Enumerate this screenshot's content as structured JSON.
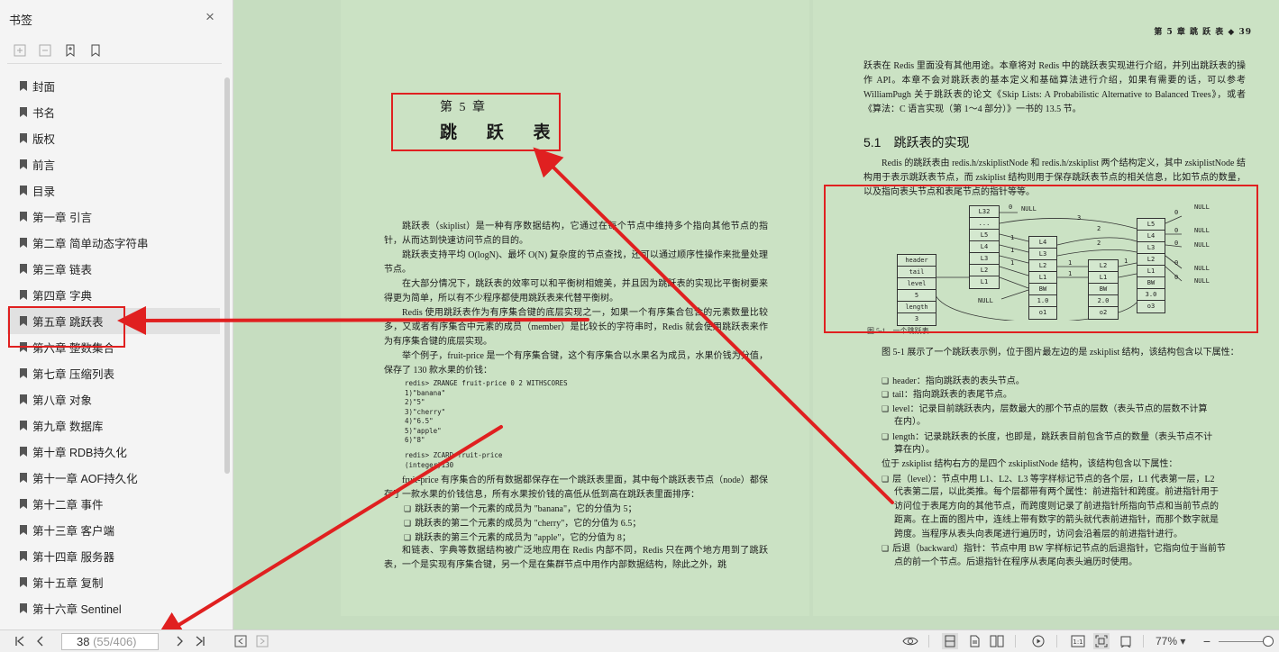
{
  "sidebar": {
    "title": "书签",
    "items": [
      {
        "label": "封面"
      },
      {
        "label": "书名"
      },
      {
        "label": "版权"
      },
      {
        "label": "前言"
      },
      {
        "label": "目录"
      },
      {
        "label": "第一章 引言"
      },
      {
        "label": "第二章 简单动态字符串"
      },
      {
        "label": "第三章 链表"
      },
      {
        "label": "第四章 字典"
      },
      {
        "label": "第五章 跳跃表",
        "selected": true
      },
      {
        "label": "第六章 整数集合"
      },
      {
        "label": "第七章 压缩列表"
      },
      {
        "label": "第八章 对象"
      },
      {
        "label": "第九章 数据库"
      },
      {
        "label": "第十章 RDB持久化"
      },
      {
        "label": "第十一章 AOF持久化"
      },
      {
        "label": "第十二章 事件"
      },
      {
        "label": "第十三章 客户端"
      },
      {
        "label": "第十四章 服务器"
      },
      {
        "label": "第十五章 复制"
      },
      {
        "label": "第十六章 Sentinel"
      }
    ]
  },
  "left_page": {
    "chapter_number": "第 5 章",
    "chapter_title": "跳 跃 表",
    "p1": "跳跃表（skiplist）是一种有序数据结构，它通过在每个节点中维持多个指向其他节点的指针，从而达到快速访问节点的目的。",
    "p2": "跳跃表支持平均 O(logN)、最坏 O(N) 复杂度的节点查找，还可以通过顺序性操作来批量处理节点。",
    "p3": "在大部分情况下，跳跃表的效率可以和平衡树相媲美，并且因为跳跃表的实现比平衡树要来得更为简单，所以有不少程序都使用跳跃表来代替平衡树。",
    "p4": "Redis 使用跳跃表作为有序集合键的底层实现之一，如果一个有序集合包含的元素数量比较多，又或者有序集合中元素的成员（member）是比较长的字符串时，Redis 就会使用跳跃表来作为有序集合键的底层实现。",
    "p5": "举个例子，fruit-price 是一个有序集合键，这个有序集合以水果名为成员，水果价钱为分值，保存了 130 款水果的价钱：",
    "code1": "redis> ZRANGE fruit-price 0 2 WITHSCORES\n1)\"banana\"\n2)\"5\"\n3)\"cherry\"\n4)\"6.5\"\n5)\"apple\"\n6)\"8\"",
    "code2": "redis> ZCARD fruit-price\n(integer)130",
    "p6": "fruit-price 有序集合的所有数据都保存在一个跳跃表里面，其中每个跳跃表节点（node）都保存了一款水果的价钱信息，所有水果按价钱的高低从低到高在跳跃表里面排序：",
    "b1": "跳跃表的第一个元素的成员为 \"banana\"，它的分值为 5；",
    "b2": "跳跃表的第二个元素的成员为 \"cherry\"，它的分值为 6.5；",
    "b3": "跳跃表的第三个元素的成员为 \"apple\"，它的分值为 8；",
    "p7": "和链表、字典等数据结构被广泛地应用在 Redis 内部不同，Redis 只在两个地方用到了跳跃表，一个是实现有序集合键，另一个是在集群节点中用作内部数据结构，除此之外，跳"
  },
  "right_page": {
    "running_head": "第 5 章  跳 跃 表  ◆  39",
    "p1": "跃表在 Redis 里面没有其他用途。本章将对 Redis 中的跳跃表实现进行介绍，并列出跳跃表的操作 API。本章不会对跳跃表的基本定义和基础算法进行介绍，如果有需要的话，可以参考 WilliamPugh 关于跳跃表的论文《Skip Lists: A Probabilistic Alternative to Balanced Trees》，或者《算法：C 语言实现（第 1～4 部分）》一书的 13.5 节。",
    "section_title": "5.1　跳跃表的实现",
    "p2": "Redis 的跳跃表由 redis.h/zskiplistNode 和 redis.h/zskiplist 两个结构定义，其中 zskiplistNode 结构用于表示跳跃表节点，而 zskiplist 结构则用于保存跳跃表节点的相关信息，比如节点的数量，以及指向表头节点和表尾节点的指针等等。",
    "figure_caption": "图 5-1　一个跳跃表",
    "p3": "图 5-1 展示了一个跳跃表示例，位于图片最左边的是 zskiplist 结构，该结构包含以下属性：",
    "b1": "header：指向跳跃表的表头节点。",
    "b2": "tail：指向跳跃表的表尾节点。",
    "b3a": "level：记录目前跳跃表内，层数最大的那个节点的层数（表头节点的层数不计算",
    "b3b": "在内）。",
    "b4a": "length：记录跳跃表的长度，也即是，跳跃表目前包含节点的数量（表头节点不计",
    "b4b": "算在内）。",
    "p4": "位于 zskiplist 结构右方的是四个 zskiplistNode 结构，该结构包含以下属性：",
    "b5a": "层（level）：节点中用 L1、L2、L3 等字样标记节点的各个层，L1 代表第一层，L2",
    "b5b": "代表第二层，以此类推。每个层都带有两个属性：前进指针和跨度。前进指针用于",
    "b5c": "访问位于表尾方向的其他节点，而跨度则记录了前进指针所指向节点和当前节点的",
    "b5d": "距离。在上面的图片中，连线上带有数字的箭头就代表前进指针，而那个数字就是",
    "b5e": "跨度。当程序从表头向表尾进行遍历时，访问会沿着层的前进指针进行。",
    "b6a": "后退（backward）指针：节点中用 BW 字样标记节点的后退指针，它指向位于当前节",
    "b6b": "点的前一个节点。后退指针在程序从表尾向表头遍历时使用。"
  },
  "diagram": {
    "zskiplist_fields": [
      "header",
      "tail",
      "level",
      "5",
      "length",
      "3"
    ],
    "head_levels": [
      "L32",
      "...",
      "L5",
      "L4",
      "L3",
      "L2",
      "L1"
    ],
    "node1": {
      "levels": [
        "L4",
        "L3",
        "L2",
        "L1"
      ],
      "bw": "BW",
      "score": "1.0",
      "obj": "o1"
    },
    "node2": {
      "levels": [
        "L2",
        "L1"
      ],
      "bw": "BW",
      "score": "2.0",
      "obj": "o2"
    },
    "node3": {
      "levels": [
        "L5",
        "L4",
        "L3",
        "L2",
        "L1"
      ],
      "bw": "BW",
      "score": "3.0",
      "obj": "o3"
    },
    "null_label": "NULL",
    "spans": [
      "0",
      "3",
      "2",
      "2",
      "1",
      "1",
      "1",
      "1",
      "1",
      "1",
      "0",
      "0",
      "0",
      "0",
      "0"
    ]
  },
  "bottombar": {
    "page_current": "38",
    "page_extra": "(55/406)",
    "zoom": "77%"
  },
  "annotation_color": "#e02020"
}
